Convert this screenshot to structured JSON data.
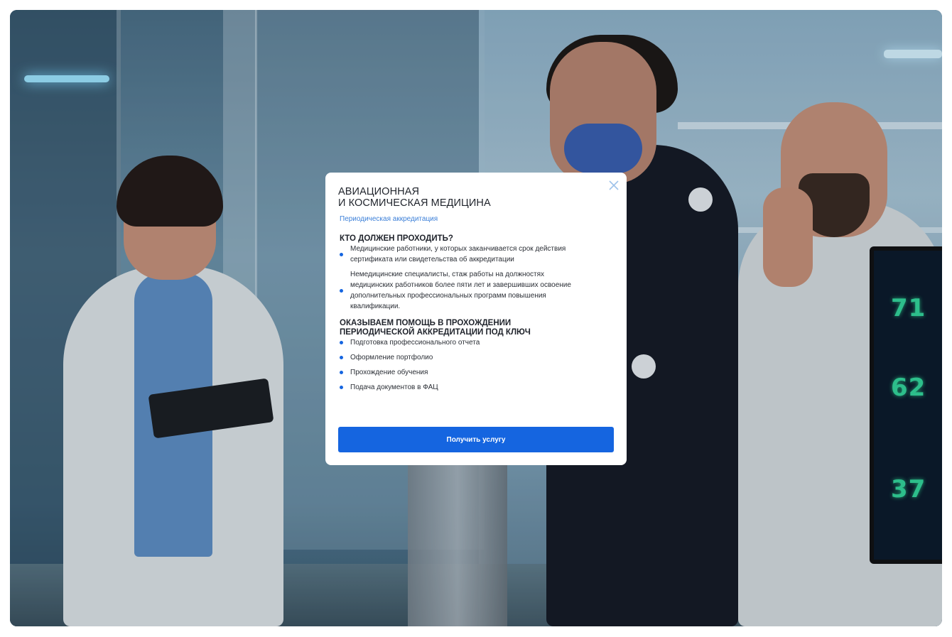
{
  "modal": {
    "title_line1": "АВИАЦИОННАЯ",
    "title_line2": "И КОСМИЧЕСКАЯ МЕДИЦИНА",
    "subtitle": "Периодическая аккредитация",
    "close_icon": "close-icon",
    "section1": {
      "heading": "КТО ДОЛЖЕН ПРОХОДИТЬ?",
      "items": [
        {
          "line1": "Медицинские работники, у которых заканчивается срок действия",
          "line2": "сертификата или свидетельства об аккредитации"
        },
        {
          "line1": "Немедицинские специалисты, стаж работы на должностях",
          "line2": "медицинских работников более пяти лет и завершивших освоение",
          "line3": "дополнительных профессиональных программ повышения",
          "line4": "квалификации."
        }
      ]
    },
    "section2": {
      "heading_line1": "ОКАЗЫВАЕМ ПОМОЩЬ В ПРОХОЖДЕНИИ",
      "heading_line2": "ПЕРИОДИЧЕСКОЙ АККРЕДИТАЦИИ ПОД КЛЮЧ",
      "items": [
        "Подготовка профессионального отчета",
        "Оформление портфолио",
        "Прохождение обучения",
        "Подача документов в ФАЦ"
      ]
    },
    "cta_label": "Получить услугу"
  },
  "background": {
    "monitor_values": [
      "71",
      "62",
      "37"
    ]
  },
  "colors": {
    "accent": "#1565e0",
    "subtitle": "#3b7fd8",
    "text": "#1f232b",
    "monitor_digits": "#33d79a"
  }
}
